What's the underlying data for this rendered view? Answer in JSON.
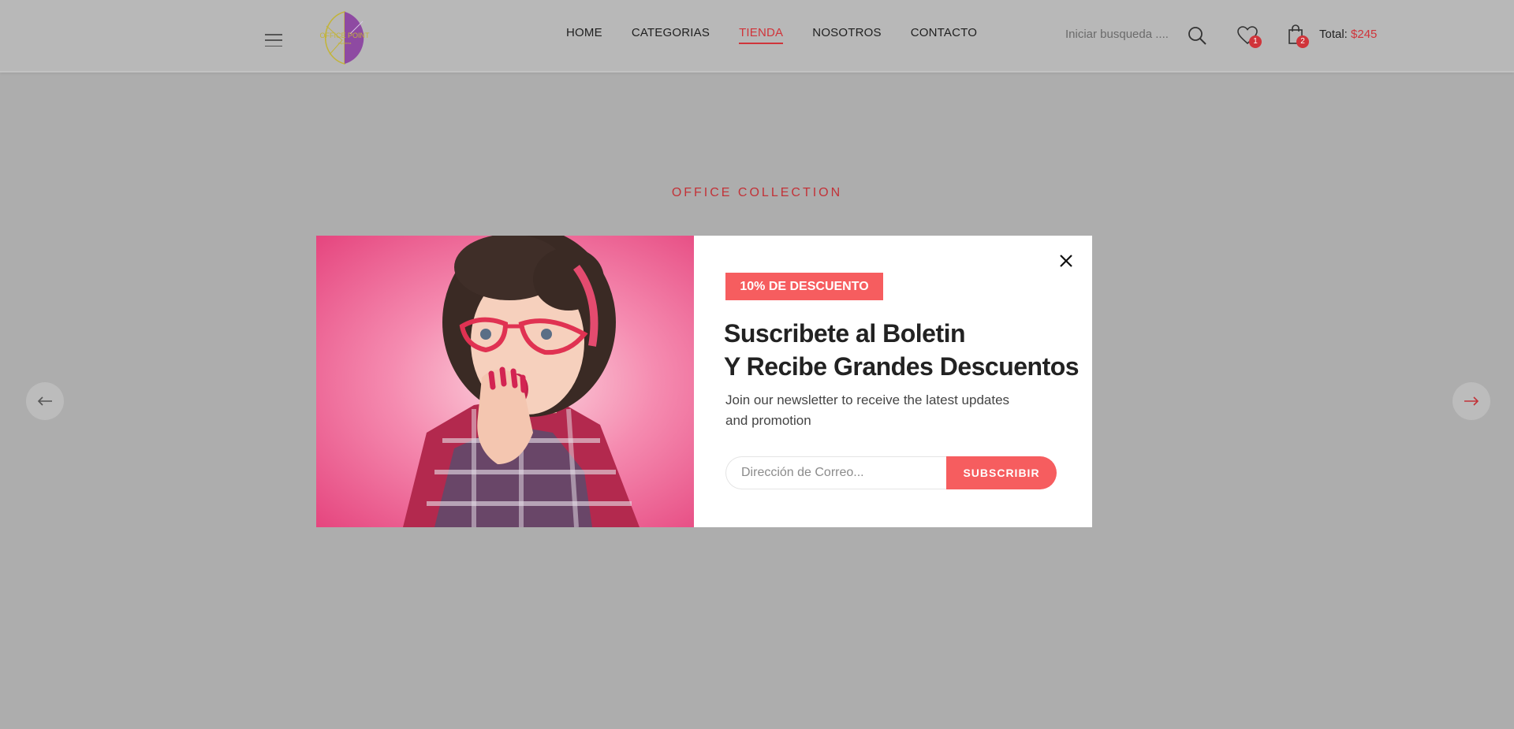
{
  "header": {
    "logo": {
      "text": "OFFICE POINT",
      "tagline": "papelería"
    },
    "nav": [
      {
        "label": "HOME",
        "active": false
      },
      {
        "label": "CATEGORIAS",
        "active": false
      },
      {
        "label": "TIENDA",
        "active": true
      },
      {
        "label": "NOSOTROS",
        "active": false
      },
      {
        "label": "CONTACTO",
        "active": false
      }
    ],
    "search_placeholder": "Iniciar busqueda ....",
    "wishlist_count": "1",
    "cart_count": "2",
    "total_label": "Total:",
    "total_value": "$245"
  },
  "hero": {
    "collection_label": "OFFICE COLLECTION"
  },
  "modal": {
    "discount_badge": "10% DE DESCUENTO",
    "title_line1": "Suscribete al Boletin",
    "title_line2": "Y Recibe Grandes Descuentos",
    "desc_line1": "Join our newsletter to receive the latest updates",
    "desc_line2": "and promotion",
    "email_placeholder": "Dirección de Correo...",
    "subscribe_label": "SUBSCRIBIR"
  },
  "icons": {
    "menu": "hamburger-menu-icon",
    "search": "search-icon",
    "wishlist": "heart-icon",
    "cart": "shopping-bag-icon",
    "close": "close-icon",
    "prev": "arrow-left-icon",
    "next": "arrow-right-icon"
  },
  "colors": {
    "accent": "#d0343a",
    "button": "#f65d5f",
    "overlay": "#adadad",
    "logo_purple": "#8e4aa2",
    "logo_gold": "#c2b43a"
  }
}
